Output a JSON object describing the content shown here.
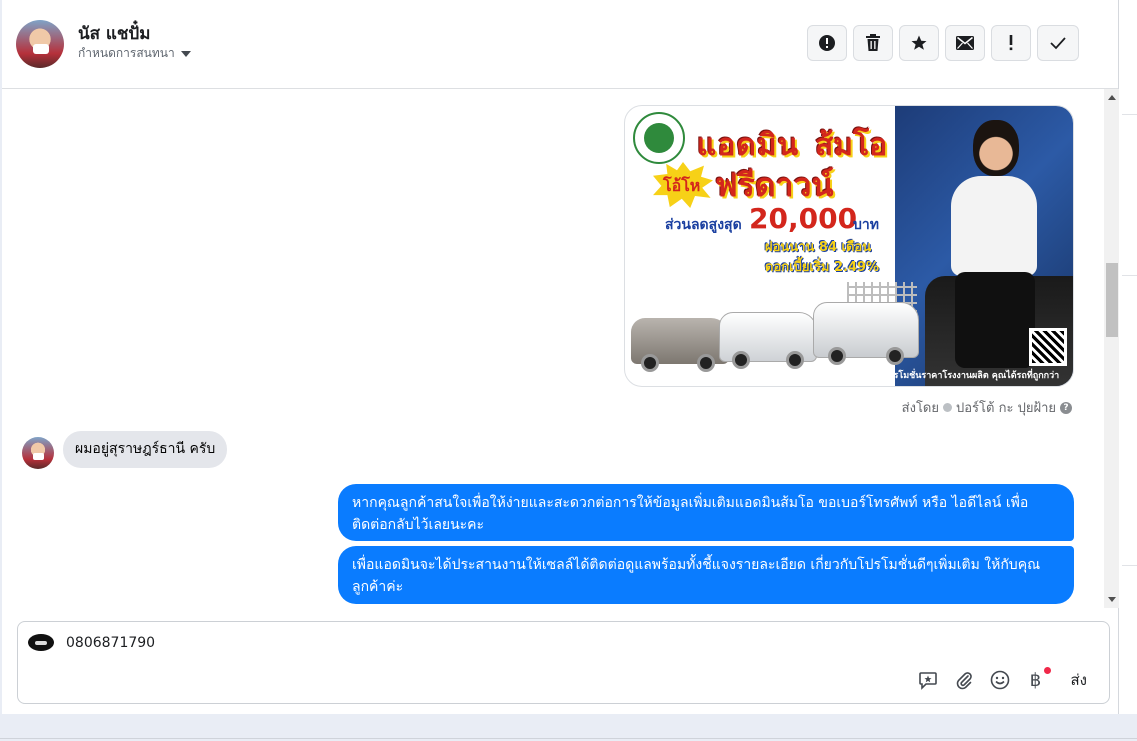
{
  "header": {
    "contact_name": "นัส แชปั๋ม",
    "assign_label": "กำหนดการสนทนา",
    "toolbar": [
      {
        "name": "spam-button",
        "icon": "alert-circle-icon"
      },
      {
        "name": "delete-button",
        "icon": "trash-icon"
      },
      {
        "name": "star-button",
        "icon": "star-icon"
      },
      {
        "name": "mark-unread-button",
        "icon": "envelope-icon"
      },
      {
        "name": "follow-up-button",
        "icon": "exclamation-icon"
      },
      {
        "name": "done-button",
        "icon": "check-icon"
      }
    ]
  },
  "ad_image": {
    "line1a": "แอดมิน",
    "line1b": "ส้มโอ",
    "burst": "โอ้โห",
    "headline": "ฟรีดาวน์",
    "discount_label": "ส่วนลดสูงสุด",
    "discount_amount": "20,000",
    "discount_unit": "บาท",
    "installment": "ผ่อนนาน 84 เดือน",
    "interest": "ดอกเบี้ยเริ่ม 2.49%",
    "footer": "โปรโมชั่นราคาโรงงานผลิต คุณได้รถที่ถูกกว่า"
  },
  "sent_by": {
    "prefix": "ส่งโดย",
    "name": "ปอร์โต้ กะ ปุยฝ้าย",
    "help": "?"
  },
  "messages": {
    "incoming": "ผมอยู่สุราษฎร์ธานี ครับ",
    "outgoing_1": "หากคุณลูกค้าสนใจเพื่อให้ง่ายและสะดวกต่อการให้ข้อมูลเพิ่มเติมแอดมินส้มโอ ขอเบอร์โทรศัพท์ หรือ ไอดีไลน์ เพื่อติดต่อกลับไว้เลยนะคะ",
    "outgoing_2": "เพื่อแอดมินจะได้ประสานงานให้เซลล์ได้ติดต่อดูแลพร้อมทั้งชี้แจงรายละเอียด เกี่ยวกับโปรโมชั่นดีๆเพิ่มเติม ให้กับคุณลูกค้าค่ะ"
  },
  "composer": {
    "value": "0806871790",
    "baht_symbol": "฿",
    "send_label": "ส่ง"
  },
  "colors": {
    "outgoing_bubble": "#0a7cff",
    "incoming_bubble": "#e4e6eb",
    "notification_dot": "#f02849"
  }
}
